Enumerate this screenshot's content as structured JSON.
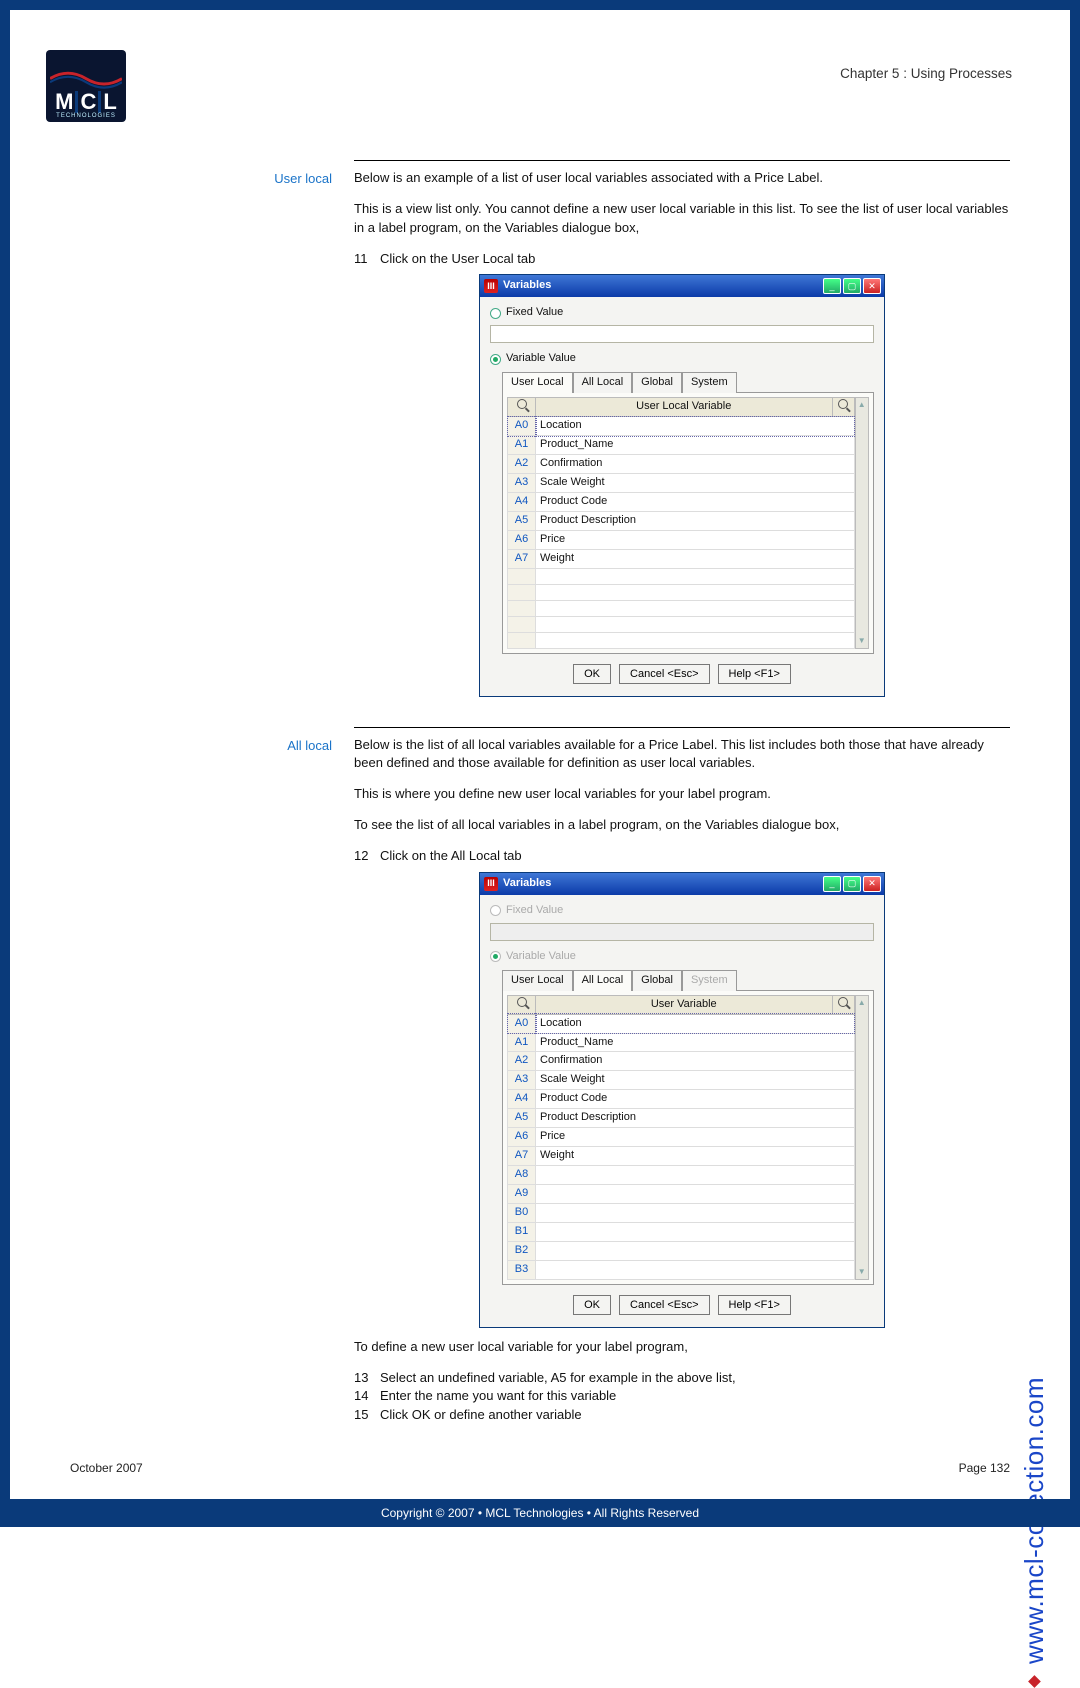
{
  "chapter_title": "Chapter 5 : Using Processes",
  "logo": {
    "m": "M",
    "c": "C",
    "l": "L",
    "tech": "TECHNOLOGIES"
  },
  "sections": {
    "user_local": {
      "label": "User local",
      "p1": "Below is an example of a list of user local variables associated with a Price Label.",
      "p2": "This is a view list only. You cannot define a new user local variable in this list. To see the list of user local variables in a label program, on the Variables dialogue box,",
      "step11_num": "11",
      "step11_text": "Click on the User Local tab"
    },
    "all_local": {
      "label": "All local",
      "p1": "Below is the list of all local variables available for a Price Label. This list includes both those that have already been defined and those available for definition as user local variables.",
      "p2": "This is where you define new user local variables for your label program.",
      "p3": "To see the list of all local variables in a label program, on the Variables dialogue box,",
      "step12_num": "12",
      "step12_text": "Click on the All Local tab",
      "tail1": "To define a new user local variable for your label program,",
      "step13_num": "13",
      "step13_text": "Select an undefined variable, A5 for example in the above list,",
      "step14_num": "14",
      "step14_text": "Enter the name you want for this variable",
      "step15_num": "15",
      "step15_text": "Click OK or define another variable"
    }
  },
  "dialog1": {
    "title": "Variables",
    "fixed_value": "Fixed Value",
    "variable_value": "Variable Value",
    "tabs": {
      "user_local": "User Local",
      "all_local": "All Local",
      "global": "Global",
      "system": "System"
    },
    "col_header": "User Local Variable",
    "rows": [
      {
        "id": "A0",
        "name": "Location"
      },
      {
        "id": "A1",
        "name": "Product_Name"
      },
      {
        "id": "A2",
        "name": "Confirmation"
      },
      {
        "id": "A3",
        "name": "Scale Weight"
      },
      {
        "id": "A4",
        "name": "Product Code"
      },
      {
        "id": "A5",
        "name": "Product Description"
      },
      {
        "id": "A6",
        "name": "Price"
      },
      {
        "id": "A7",
        "name": "Weight"
      }
    ],
    "empty_rows": 5,
    "btn_ok": "OK",
    "btn_cancel": "Cancel <Esc>",
    "btn_help": "Help <F1>"
  },
  "dialog2": {
    "title": "Variables",
    "fixed_value": "Fixed Value",
    "variable_value": "Variable Value",
    "tabs": {
      "user_local": "User Local",
      "all_local": "All Local",
      "global": "Global",
      "system": "System"
    },
    "col_header": "User Variable",
    "rows": [
      {
        "id": "A0",
        "name": "Location"
      },
      {
        "id": "A1",
        "name": "Product_Name"
      },
      {
        "id": "A2",
        "name": "Confirmation"
      },
      {
        "id": "A3",
        "name": "Scale Weight"
      },
      {
        "id": "A4",
        "name": "Product Code"
      },
      {
        "id": "A5",
        "name": "Product Description"
      },
      {
        "id": "A6",
        "name": "Price"
      },
      {
        "id": "A7",
        "name": "Weight"
      },
      {
        "id": "A8",
        "name": ""
      },
      {
        "id": "A9",
        "name": ""
      },
      {
        "id": "B0",
        "name": ""
      },
      {
        "id": "B1",
        "name": ""
      },
      {
        "id": "B2",
        "name": ""
      },
      {
        "id": "B3",
        "name": ""
      }
    ],
    "btn_ok": "OK",
    "btn_cancel": "Cancel <Esc>",
    "btn_help": "Help <F1>"
  },
  "side_url": "www.mcl-collection.com",
  "footer": {
    "date": "October 2007",
    "page": "Page 132"
  },
  "copyright": "Copyright © 2007 • MCL Technologies • All Rights Reserved"
}
